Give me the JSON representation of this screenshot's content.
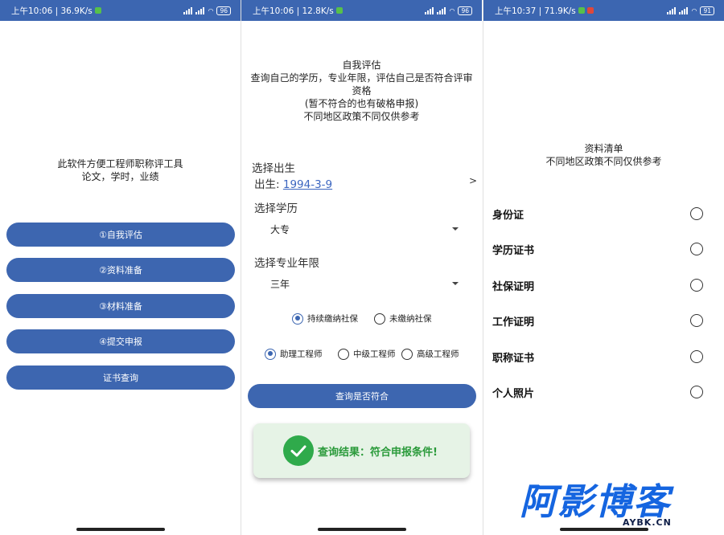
{
  "screens": [
    {
      "status": {
        "time": "上午10:06",
        "speed": "36.9K/s",
        "signal": "5G",
        "battery": "96"
      },
      "intro": {
        "line1": "此软件方便工程师职称评工具",
        "line2": "论文，学时，业绩"
      },
      "menu": [
        "①自我评估",
        "②资料准备",
        "③材料准备",
        "④提交申报",
        "证书查询"
      ]
    },
    {
      "status": {
        "time": "上午10:06",
        "speed": "12.8K/s",
        "signal": "5G",
        "battery": "96"
      },
      "heading": {
        "title": "自我评估",
        "line1": "查询自己的学历，专业年限，评估自己是否符合评审",
        "line2": "资格",
        "line3": "(暂不符合的也有破格申报)",
        "line4": "不同地区政策不同仅供参考"
      },
      "birth": {
        "label": "选择出生",
        "prefix": "出生:",
        "value": "1994-3-9",
        "arrow": ">"
      },
      "education": {
        "label": "选择学历",
        "value": "大专"
      },
      "years": {
        "label": "选择专业年限",
        "value": "三年"
      },
      "social": {
        "options": [
          "持续缴纳社保",
          "未缴纳社保"
        ],
        "selected": 0
      },
      "level": {
        "options": [
          "助理工程师",
          "中级工程师",
          "高级工程师"
        ],
        "selected": 0
      },
      "query_button": "查询是否符合",
      "toast": "查询结果：符合申报条件!"
    },
    {
      "status": {
        "time": "上午10:37",
        "speed": "71.9K/s",
        "signal": "5G",
        "battery": "91"
      },
      "heading": {
        "title": "资料清单",
        "subtitle": "不同地区政策不同仅供参考"
      },
      "items": [
        "身份证",
        "学历证书",
        "社保证明",
        "工作证明",
        "职称证书",
        "个人照片"
      ]
    }
  ],
  "watermark": {
    "main": "阿影博客",
    "url": "AYBK.CN"
  },
  "colors": {
    "primary": "#3d66b0",
    "success": "#2faa4b",
    "toast_bg": "#e6f3e6"
  }
}
